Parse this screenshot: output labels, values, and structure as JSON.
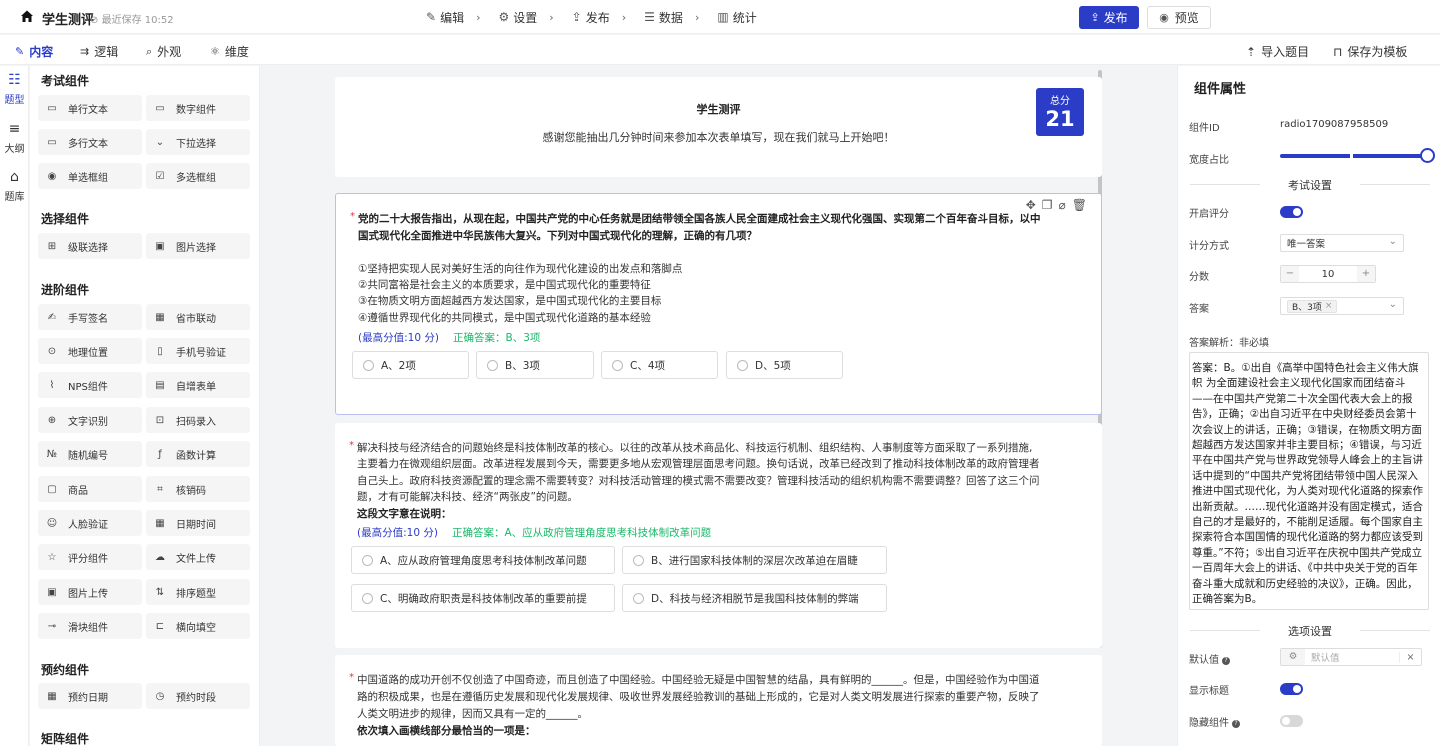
{
  "app": {
    "title": "学生测评",
    "save_status": "最近保存 10:52"
  },
  "steps": [
    {
      "label": "编辑",
      "icon": "edit-icon"
    },
    {
      "label": "设置",
      "icon": "gear-icon"
    },
    {
      "label": "发布",
      "icon": "publish-icon"
    },
    {
      "label": "数据",
      "icon": "data-icon"
    },
    {
      "label": "统计",
      "icon": "stats-icon"
    }
  ],
  "header_buttons": {
    "publish": "发布",
    "preview": "预览"
  },
  "subtabs": [
    "内容",
    "逻辑",
    "外观",
    "维度"
  ],
  "sub_actions": {
    "import": "导入题目",
    "save_template": "保存为模板"
  },
  "rail": [
    "题型",
    "大纲",
    "题库"
  ],
  "palette": {
    "groups": [
      {
        "title": "考试组件",
        "items": [
          "单行文本",
          "数字组件",
          "多行文本",
          "下拉选择",
          "单选框组",
          "多选框组"
        ]
      },
      {
        "title": "选择组件",
        "items": [
          "级联选择",
          "图片选择"
        ]
      },
      {
        "title": "进阶组件",
        "items": [
          "手写签名",
          "省市联动",
          "地理位置",
          "手机号验证",
          "NPS组件",
          "自增表单",
          "文字识别",
          "扫码录入",
          "随机编号",
          "函数计算",
          "商品",
          "核销码",
          "人脸验证",
          "日期时间",
          "评分组件",
          "文件上传",
          "图片上传",
          "排序题型",
          "滑块组件",
          "横向填空"
        ]
      },
      {
        "title": "预约组件",
        "items": [
          "预约日期",
          "预约时段"
        ]
      },
      {
        "title": "矩阵组件",
        "items": []
      }
    ]
  },
  "form": {
    "title": "学生测评",
    "description": "感谢您能抽出几分钟时间来参加本次表单填写，现在我们就马上开始吧！",
    "score_label": "总分",
    "score_value": "21"
  },
  "questions": [
    {
      "lines": [
        "党的二十大报告指出，从现在起，中国共产党的中心任务就是团结带领全国各族人民全面建成社会主义现代化强国、实现第二个百年奋斗目标，以中",
        "国式现代化全面推进中华民族伟大复兴。下列对中国式现代化的理解，正确的有几项？"
      ],
      "statements": [
        "①坚持把实现人民对美好生活的向往作为现代化建设的出发点和落脚点",
        "②共同富裕是社会主义的本质要求，是中国式现代化的重要特征",
        "③在物质文明方面超越西方发达国家，是中国式现代化的主要目标",
        "④遵循世界现代化的共同模式，是中国式现代化道路的基本经验"
      ],
      "max_score": "(最高分值:10 分)",
      "answer": "正确答案：B、3项",
      "options": [
        "A、2项",
        "B、3项",
        "C、4项",
        "D、5项"
      ]
    },
    {
      "lines": [
        "解决科技与经济结合的问题始终是科技体制改革的核心。以往的改革从技术商品化、科技运行机制、组织结构、人事制度等方面采取了一系列措施,",
        "主要着力在微观组织层面。改革进程发展到今天，需要更多地从宏观管理层面思考问题。换句话说，改革已经改到了推动科技体制改革的政府管理者",
        "自己头上。政府科技资源配置的理念需不需要转变？对科技活动管理的模式需不需要改变？管理科技活动的组织机构需不需要调整？回答了这三个问",
        "题，才有可能解决科技、经济“两张皮”的问题。"
      ],
      "prompt": "这段文字意在说明：",
      "max_score": "(最高分值:10 分)",
      "answer": "正确答案：A、应从政府管理角度思考科技体制改革问题",
      "options": [
        "A、应从政府管理角度思考科技体制改革问题",
        "B、进行国家科技体制的深层次改革迫在眉睫",
        "C、明确政府职责是科技体制改革的重要前提",
        "D、科技与经济相脱节是我国科技体制的弊端"
      ]
    },
    {
      "lines": [
        "中国道路的成功开创不仅创造了中国奇迹，而且创造了中国经验。中国经验无疑是中国智慧的结晶，具有鲜明的______。但是，中国经验作为中国道",
        "路的积极成果，也是在遵循历史发展和现代化发展规律、吸收世界发展经验教训的基础上形成的，它是对人类文明发展进行探索的重要产物，反映了",
        "人类文明进步的规律，因而又具有一定的______。"
      ],
      "prompt": "依次填入画横线部分最恰当的一项是："
    }
  ],
  "props": {
    "title": "组件属性",
    "component_id_label": "组件ID",
    "component_id": "radio1709087958509",
    "width_label": "宽度占比",
    "width_ratio": 1.0,
    "exam_section": "考试设置",
    "enable_score_label": "开启评分",
    "enable_score": true,
    "score_method_label": "计分方式",
    "score_method": "唯一答案",
    "score_label": "分数",
    "score": "10",
    "answer_label": "答案",
    "answer_tag": "B、3项",
    "explain_label": "答案解析：非必填",
    "explain_text": "答案：B。①出自《高举中国特色社会主义伟大旗帜 为全面建设社会主义现代化国家而团结奋斗——在中国共产党第二十次全国代表大会上的报告》，正确；②出自习近平在中央财经委员会第十次会议上的讲话，正确；③错误，在物质文明方面超越西方发达国家并非主要目标；④错误，与习近平在中国共产党与世界政党领导人峰会上的主旨讲话中提到的“中国共产党将团结带领中国人民深入推进中国式现代化，为人类对现代化道路的探索作出新贡献。……现代化道路并没有固定模式，适合自己的才是最好的，不能削足适履。每个国家自主探索符合本国国情的现代化道路的努力都应该受到尊重。”不符；⑤出自习近平在庆祝中国共产党成立一百周年大会上的讲话、《中共中央关于党的百年奋斗重大成就和历史经验的决议》，正确。因此，正确答案为B。",
    "option_section": "选项设置",
    "default_label": "默认值",
    "default_placeholder": "默认值",
    "show_title_label": "显示标题",
    "show_title": true,
    "hide_label": "隐藏组件",
    "hide": false
  },
  "colors": {
    "accent": "#2b3dc6",
    "answer": "#1cb86a",
    "required": "#ee3333"
  }
}
